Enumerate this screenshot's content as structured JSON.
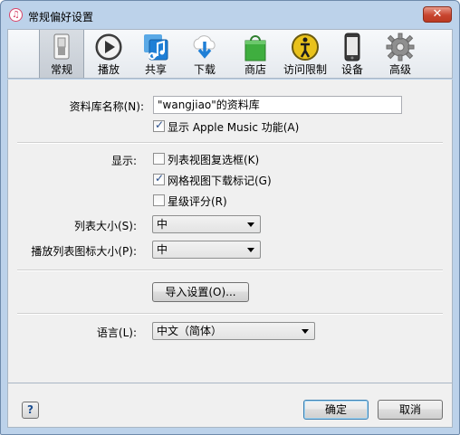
{
  "window": {
    "title": "常规偏好设置",
    "close_glyph": "✕",
    "app_icon": "itunes-note-icon"
  },
  "toolbar": {
    "items": [
      {
        "label": "常规",
        "icon": "general-switch-icon",
        "active": true
      },
      {
        "label": "播放",
        "icon": "play-icon",
        "active": false
      },
      {
        "label": "共享",
        "icon": "sharing-music-icon",
        "active": false
      },
      {
        "label": "下载",
        "icon": "download-cloud-icon",
        "active": false
      },
      {
        "label": "商店",
        "icon": "store-bag-icon",
        "active": false
      },
      {
        "label": "访问限制",
        "icon": "restrictions-icon",
        "active": false
      },
      {
        "label": "设备",
        "icon": "device-phone-icon",
        "active": false
      },
      {
        "label": "高级",
        "icon": "gear-icon",
        "active": false
      }
    ]
  },
  "general": {
    "library_name_label": "资料库名称(N):",
    "library_name_value": "\"wangjiao\"的资料库",
    "apple_music_checkbox": {
      "label": "显示 Apple Music 功能(A)",
      "checked": true
    },
    "show_label": "显示:",
    "show_options": [
      {
        "label": "列表视图复选框(K)",
        "checked": false
      },
      {
        "label": "网格视图下载标记(G)",
        "checked": true
      },
      {
        "label": "星级评分(R)",
        "checked": false
      }
    ],
    "list_size_label": "列表大小(S):",
    "list_size_value": "中",
    "playlist_icon_size_label": "播放列表图标大小(P):",
    "playlist_icon_size_value": "中",
    "import_button": "导入设置(O)...",
    "language_label": "语言(L):",
    "language_value": "中文（简体）"
  },
  "footer": {
    "help_label": "?",
    "ok_label": "确定",
    "cancel_label": "取消"
  },
  "colors": {
    "accent_blue": "#1f7fd6",
    "store_green": "#3fae3f",
    "title_bar": "#bcd2ea",
    "close_red": "#c8452f"
  }
}
